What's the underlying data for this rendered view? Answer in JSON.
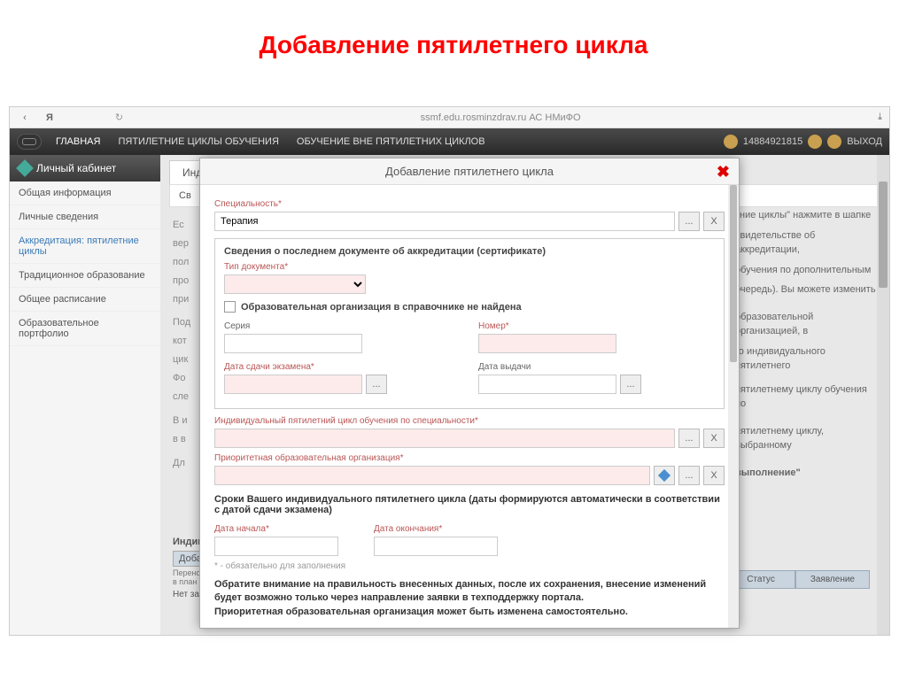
{
  "slide_title": "Добавление пятилетнего цикла",
  "browser": {
    "yandex": "Я",
    "refresh": "↻",
    "url": "ssmf.edu.rosminzdrav.ru  АС НМиФО",
    "download": "⤓"
  },
  "nav": {
    "main": "ГЛАВНАЯ",
    "menu1": "ПЯТИЛЕТНИЕ ЦИКЛЫ ОБУЧЕНИЯ",
    "menu2": "ОБУЧЕНИЕ ВНЕ ПЯТИЛЕТНИХ ЦИКЛОВ",
    "user_id": "14884921815",
    "logout": "ВЫХОД"
  },
  "sidebar": {
    "header": "Личный кабинет",
    "items": [
      "Общая информация",
      "Личные сведения",
      "Аккредитация: пятилетние циклы",
      "Традиционное образование",
      "Общее расписание",
      "Образовательное портфолио"
    ]
  },
  "content": {
    "tab": "Индив",
    "sv": "Св",
    "bg_text": [
      "Ес",
      "вер",
      "пол",
      "про",
      "при",
      "Под",
      "кот",
      "цик",
      "Фо",
      "сле",
      "В и",
      "в в",
      "Дл"
    ],
    "right_fragments": [
      "тние циклы\" нажмите в шапке",
      "свидетельстве об аккредитации,",
      "обучения по дополнительным",
      "очередь). Вы можете изменить",
      "образовательной организацией, в",
      "го индивидуального пятилетнего",
      "пятилетнему циклу обучения по",
      "пятилетнему циклу, выбранному",
      "выполнение\""
    ],
    "bottom_section": "Индиви",
    "bottom_btn": "Добав",
    "bottom_row1": "Перенос",
    "bottom_row2": "в план",
    "bottom_none": "Нет зап",
    "th_status": "Статус",
    "th_zayav": "Заявление"
  },
  "modal": {
    "title": "Добавление пятилетнего цикла",
    "spec_label": "Специальность*",
    "spec_value": "Терапия",
    "dots": "...",
    "x": "X",
    "fieldset_title": "Сведения о последнем документе об аккредитации (сертификате)",
    "doctype_label": "Тип документа*",
    "checkbox_label": "Образовательная организация в справочнике не найдена",
    "series_label": "Серия",
    "number_label": "Номер*",
    "exam_date_label": "Дата сдачи экзамена*",
    "issue_date_label": "Дата выдачи",
    "cycle_spec_label": "Индивидуальный пятилетний цикл обучения по специальности*",
    "prior_org_label": "Приоритетная образовательная организация*",
    "dates_section": "Сроки Вашего индивидуального пятилетнего цикла (даты формируются автоматически в соответствии с датой сдачи экзамена)",
    "start_date_label": "Дата начала*",
    "end_date_label": "Дата окончания*",
    "footnote": "* - обязательно для заполнения",
    "warning": "Обратите внимание на правильность внесенных данных, после их сохранения, внесение изменений будет возможно только через направление заявки в техподдержку портала.",
    "warning2": "Приоритетная образовательная организация может быть изменена самостоятельно."
  }
}
